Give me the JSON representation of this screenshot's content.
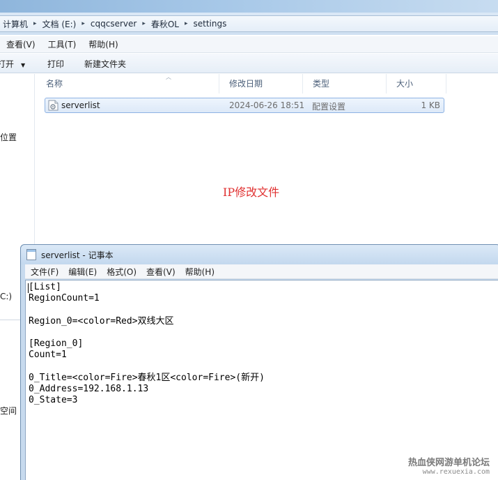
{
  "breadcrumb": [
    "计算机",
    "文档 (E:)",
    "cqqcserver",
    "春秋OL",
    "settings"
  ],
  "menu": [
    "查看(V)",
    "工具(T)",
    "帮助(H)"
  ],
  "commands": {
    "open": "打开",
    "print": "打印",
    "new_folder": "新建文件夹"
  },
  "nav": {
    "locations": "位置",
    "drive": "C:)",
    "free_space": "空间"
  },
  "columns": {
    "name": "名称",
    "modified": "修改日期",
    "type": "类型",
    "size": "大小"
  },
  "file": {
    "name": "serverlist",
    "modified": "2024-06-26 18:51",
    "type": "配置设置",
    "size": "1 KB",
    "icon": "settings-file-icon"
  },
  "annotation": "IP修改文件",
  "notepad": {
    "title": "serverlist - 记事本",
    "menu": [
      "文件(F)",
      "编辑(E)",
      "格式(O)",
      "查看(V)",
      "帮助(H)"
    ],
    "content": "[List]\nRegionCount=1\n\nRegion_0=<color=Red>双线大区\n\n[Region_0]\nCount=1\n\n0_Title=<color=Fire>春秋1区<color=Fire>(新开)\n0_Address=192.168.1.13\n0_State=3"
  },
  "watermark": {
    "line1": "热血侠网游单机论坛",
    "line2": "www.rexuexia.com"
  },
  "colors": {
    "annotation": "#e03030",
    "selection": "#dde9f8"
  }
}
